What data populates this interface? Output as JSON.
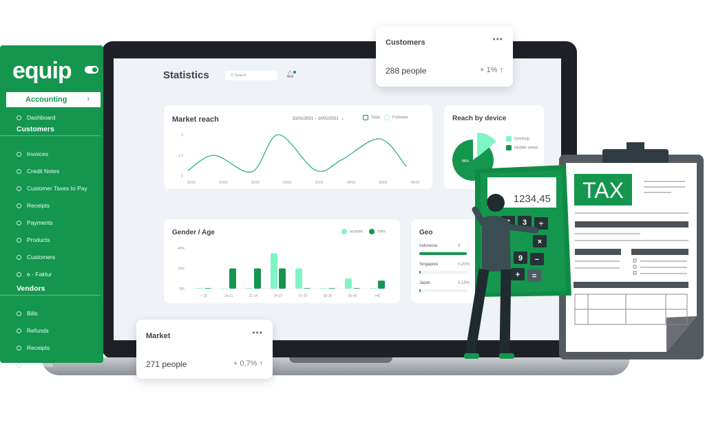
{
  "colors": {
    "brand": "#14964f",
    "accent_light": "#7ff5c6",
    "dark": "#2f3d42"
  },
  "sidebar": {
    "logo": "equip",
    "active_module": "Accounting",
    "dashboard": "Dashboard",
    "sections": [
      {
        "title": "Customers",
        "items": [
          "Invoices",
          "Credit Notes",
          "Customer Taxes to Pay",
          "Receipts",
          "Payments",
          "Products",
          "Customers",
          "e - Faktur"
        ]
      },
      {
        "title": "Vendors",
        "items": [
          "Bills",
          "Refunds",
          "Receipts",
          "Payments"
        ]
      }
    ]
  },
  "header": {
    "title": "Statistics",
    "search_placeholder": "Search",
    "icon": "bell-icon"
  },
  "customers_card": {
    "title": "Customers",
    "value": "288 people",
    "change": "+ 1%"
  },
  "market_card": {
    "title": "Market",
    "value": "271 people",
    "change": "+ 0,7%"
  },
  "market_reach": {
    "title": "Market reach",
    "date_range": "31/01/2021 – 10/02/2021",
    "legend": [
      "Total",
      "Follower"
    ]
  },
  "reach_device": {
    "title": "Reach by device",
    "legend": [
      "Desktop",
      "Mobile views"
    ],
    "mobile_label": "86%"
  },
  "geo": {
    "title": "Geo",
    "rows": [
      {
        "country": "Indonesia",
        "value": "9",
        "fill": 0.98
      },
      {
        "country": "Singapore",
        "value": "0,20%",
        "fill": 0.02
      },
      {
        "country": "Japan",
        "value": "0,13%",
        "fill": 0.013
      }
    ]
  },
  "calculator": {
    "display": "1234,45",
    "keys": [
      "2",
      "3",
      "÷",
      "×",
      "9",
      "−",
      "+",
      "="
    ]
  },
  "tax_form": {
    "label": "TAX"
  },
  "chart_data": [
    {
      "type": "line",
      "title": "Market reach",
      "categories": [
        "31/01",
        "01/02",
        "02/02",
        "03/02",
        "31/01",
        "04/02",
        "05/02",
        "06/02"
      ],
      "y_ticks": [
        "0",
        "1,5",
        "3"
      ],
      "ylim": [
        0,
        3
      ],
      "series": [
        {
          "name": "Total",
          "values": [
            0.4,
            1.5,
            0.3,
            3.0,
            0.4,
            1.2,
            2.7,
            0.7
          ]
        }
      ]
    },
    {
      "type": "bar",
      "title": "Gender / Age",
      "categories": [
        "< 18",
        "18-21",
        "21-24",
        "24-27",
        "27-30",
        "30-35",
        "35-40",
        ">40"
      ],
      "y_ticks": [
        "0%",
        "20%",
        "40%"
      ],
      "ylim": [
        0,
        40
      ],
      "series": [
        {
          "name": "women",
          "values": [
            0.5,
            0,
            0.5,
            35,
            20,
            0.5,
            10,
            0.5
          ]
        },
        {
          "name": "men",
          "values": [
            0.5,
            20,
            20,
            20,
            0.5,
            0.5,
            0.5,
            8
          ]
        }
      ]
    },
    {
      "type": "pie",
      "title": "Reach by device",
      "labels": [
        "Mobile views",
        "Desktop"
      ],
      "values": [
        86,
        14
      ]
    }
  ]
}
